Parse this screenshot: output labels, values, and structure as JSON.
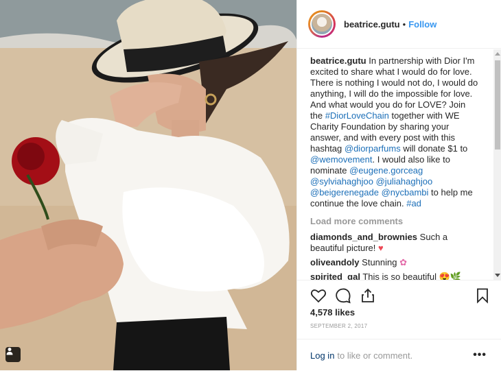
{
  "post": {
    "username": "beatrice.gutu",
    "follow_label": "Follow",
    "separator": "•",
    "caption_parts": [
      {
        "text": "In partnership with Dior I'm excited to share what I would do for love. There is nothing I would not do, I would do anything, I will do the impossible for love. And what would you do for LOVE? Join the ",
        "kind": "text"
      },
      {
        "text": "#DiorLoveChain",
        "kind": "tag"
      },
      {
        "text": " together with WE Charity Foundation by sharing your answer, and with every post with this hashtag ",
        "kind": "text"
      },
      {
        "text": "@diorparfums",
        "kind": "tag"
      },
      {
        "text": " will donate $1 to ",
        "kind": "text"
      },
      {
        "text": "@wemovement",
        "kind": "tag"
      },
      {
        "text": ". I would also like to nominate ",
        "kind": "text"
      },
      {
        "text": "@eugene.gorceag",
        "kind": "tag"
      },
      {
        "text": " ",
        "kind": "text"
      },
      {
        "text": "@sylviahaghjoo",
        "kind": "tag"
      },
      {
        "text": " ",
        "kind": "text"
      },
      {
        "text": "@juliahaghjoo",
        "kind": "tag"
      },
      {
        "text": " ",
        "kind": "text"
      },
      {
        "text": "@beigerenegade",
        "kind": "tag"
      },
      {
        "text": " ",
        "kind": "text"
      },
      {
        "text": "@nycbambi",
        "kind": "tag"
      },
      {
        "text": " to help me continue the love chain. ",
        "kind": "text"
      },
      {
        "text": "#ad",
        "kind": "tag"
      }
    ],
    "load_more_label": "Load more comments",
    "comments": [
      {
        "user": "diamonds_and_brownies",
        "text": "Such a beautiful picture!",
        "emoji": "♥",
        "emoji_class": "heart-emoji"
      },
      {
        "user": "oliveandoly",
        "text": "Stunning",
        "emoji": "✿",
        "emoji_class": "flower-emoji"
      },
      {
        "user": "spirited_gal",
        "text": "This is so beautiful",
        "emoji": "😍🌿",
        "emoji_class": "heart-emoji"
      }
    ],
    "likes": "4,578 likes",
    "date": "SEPTEMBER 2, 2017",
    "login_link": "Log in",
    "login_text": "to like or comment.",
    "more_label": "•••"
  },
  "icons": {
    "like": "heart-outline-icon",
    "comment": "speech-bubble-icon",
    "share": "share-icon",
    "save": "bookmark-icon",
    "user_tag": "person-tag-icon"
  },
  "colors": {
    "link_blue": "#3897f0",
    "tag_blue": "#1c6fb8",
    "muted": "#999999",
    "text": "#262626"
  }
}
